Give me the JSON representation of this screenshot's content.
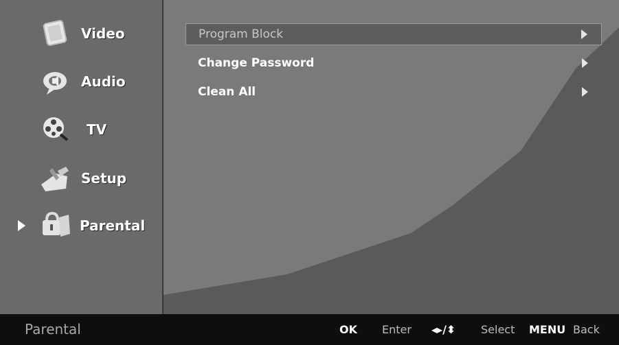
{
  "sidebar": {
    "items": [
      {
        "label": "Video",
        "icon": "video-icon"
      },
      {
        "label": "Audio",
        "icon": "audio-icon"
      },
      {
        "label": "TV",
        "icon": "tv-reel-icon"
      },
      {
        "label": "Setup",
        "icon": "setup-icon"
      },
      {
        "label": "Parental",
        "icon": "parental-lock-icon",
        "active": true
      }
    ]
  },
  "menu": {
    "items": [
      {
        "label": "Program Block",
        "selected": true
      },
      {
        "label": "Change Password"
      },
      {
        "label": "Clean All"
      }
    ]
  },
  "bottom_bar": {
    "title": "Parental",
    "ok_key": "OK",
    "ok_action": "Enter",
    "nav_keys": "◂▸/⬍",
    "nav_action": "Select",
    "menu_key": "MENU",
    "menu_action": "Back"
  },
  "colors": {
    "background": "#5c5c5c",
    "bottom_bar": "#0e0e0e",
    "text": "#ffffff"
  }
}
